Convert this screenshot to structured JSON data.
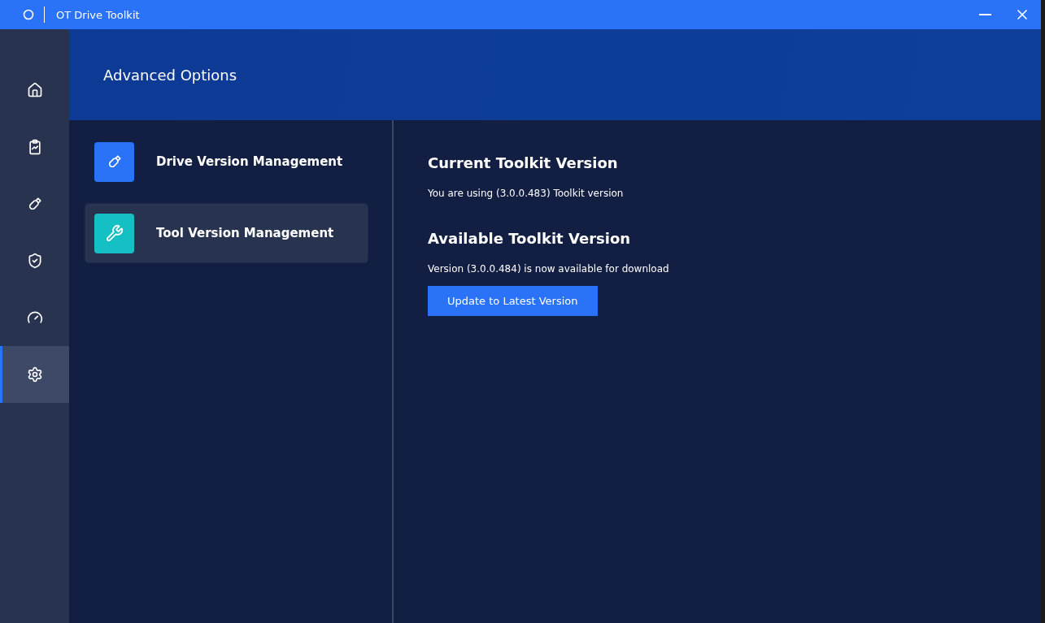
{
  "window": {
    "title": "OT Drive Toolkit"
  },
  "sidebar": {
    "items": [
      {
        "kind": "home",
        "selected": false
      },
      {
        "kind": "report",
        "selected": false
      },
      {
        "kind": "drive",
        "selected": false
      },
      {
        "kind": "shield",
        "selected": false
      },
      {
        "kind": "gauge",
        "selected": false
      },
      {
        "kind": "settings",
        "selected": true
      }
    ]
  },
  "header": {
    "title": "Advanced Options"
  },
  "options": [
    {
      "kind": "drive",
      "label": "Drive Version Management",
      "color": "#2a72f7",
      "selected": false
    },
    {
      "kind": "tool",
      "label": "Tool Version Management",
      "color": "#14c0c4",
      "selected": true
    }
  ],
  "content": {
    "current_heading": "Current Toolkit Version",
    "current_text": "You are using (3.0.0.483) Toolkit version",
    "available_heading": "Available Toolkit Version",
    "available_text": "Version (3.0.0.484) is now available for download",
    "button": "Update to Latest Version"
  }
}
